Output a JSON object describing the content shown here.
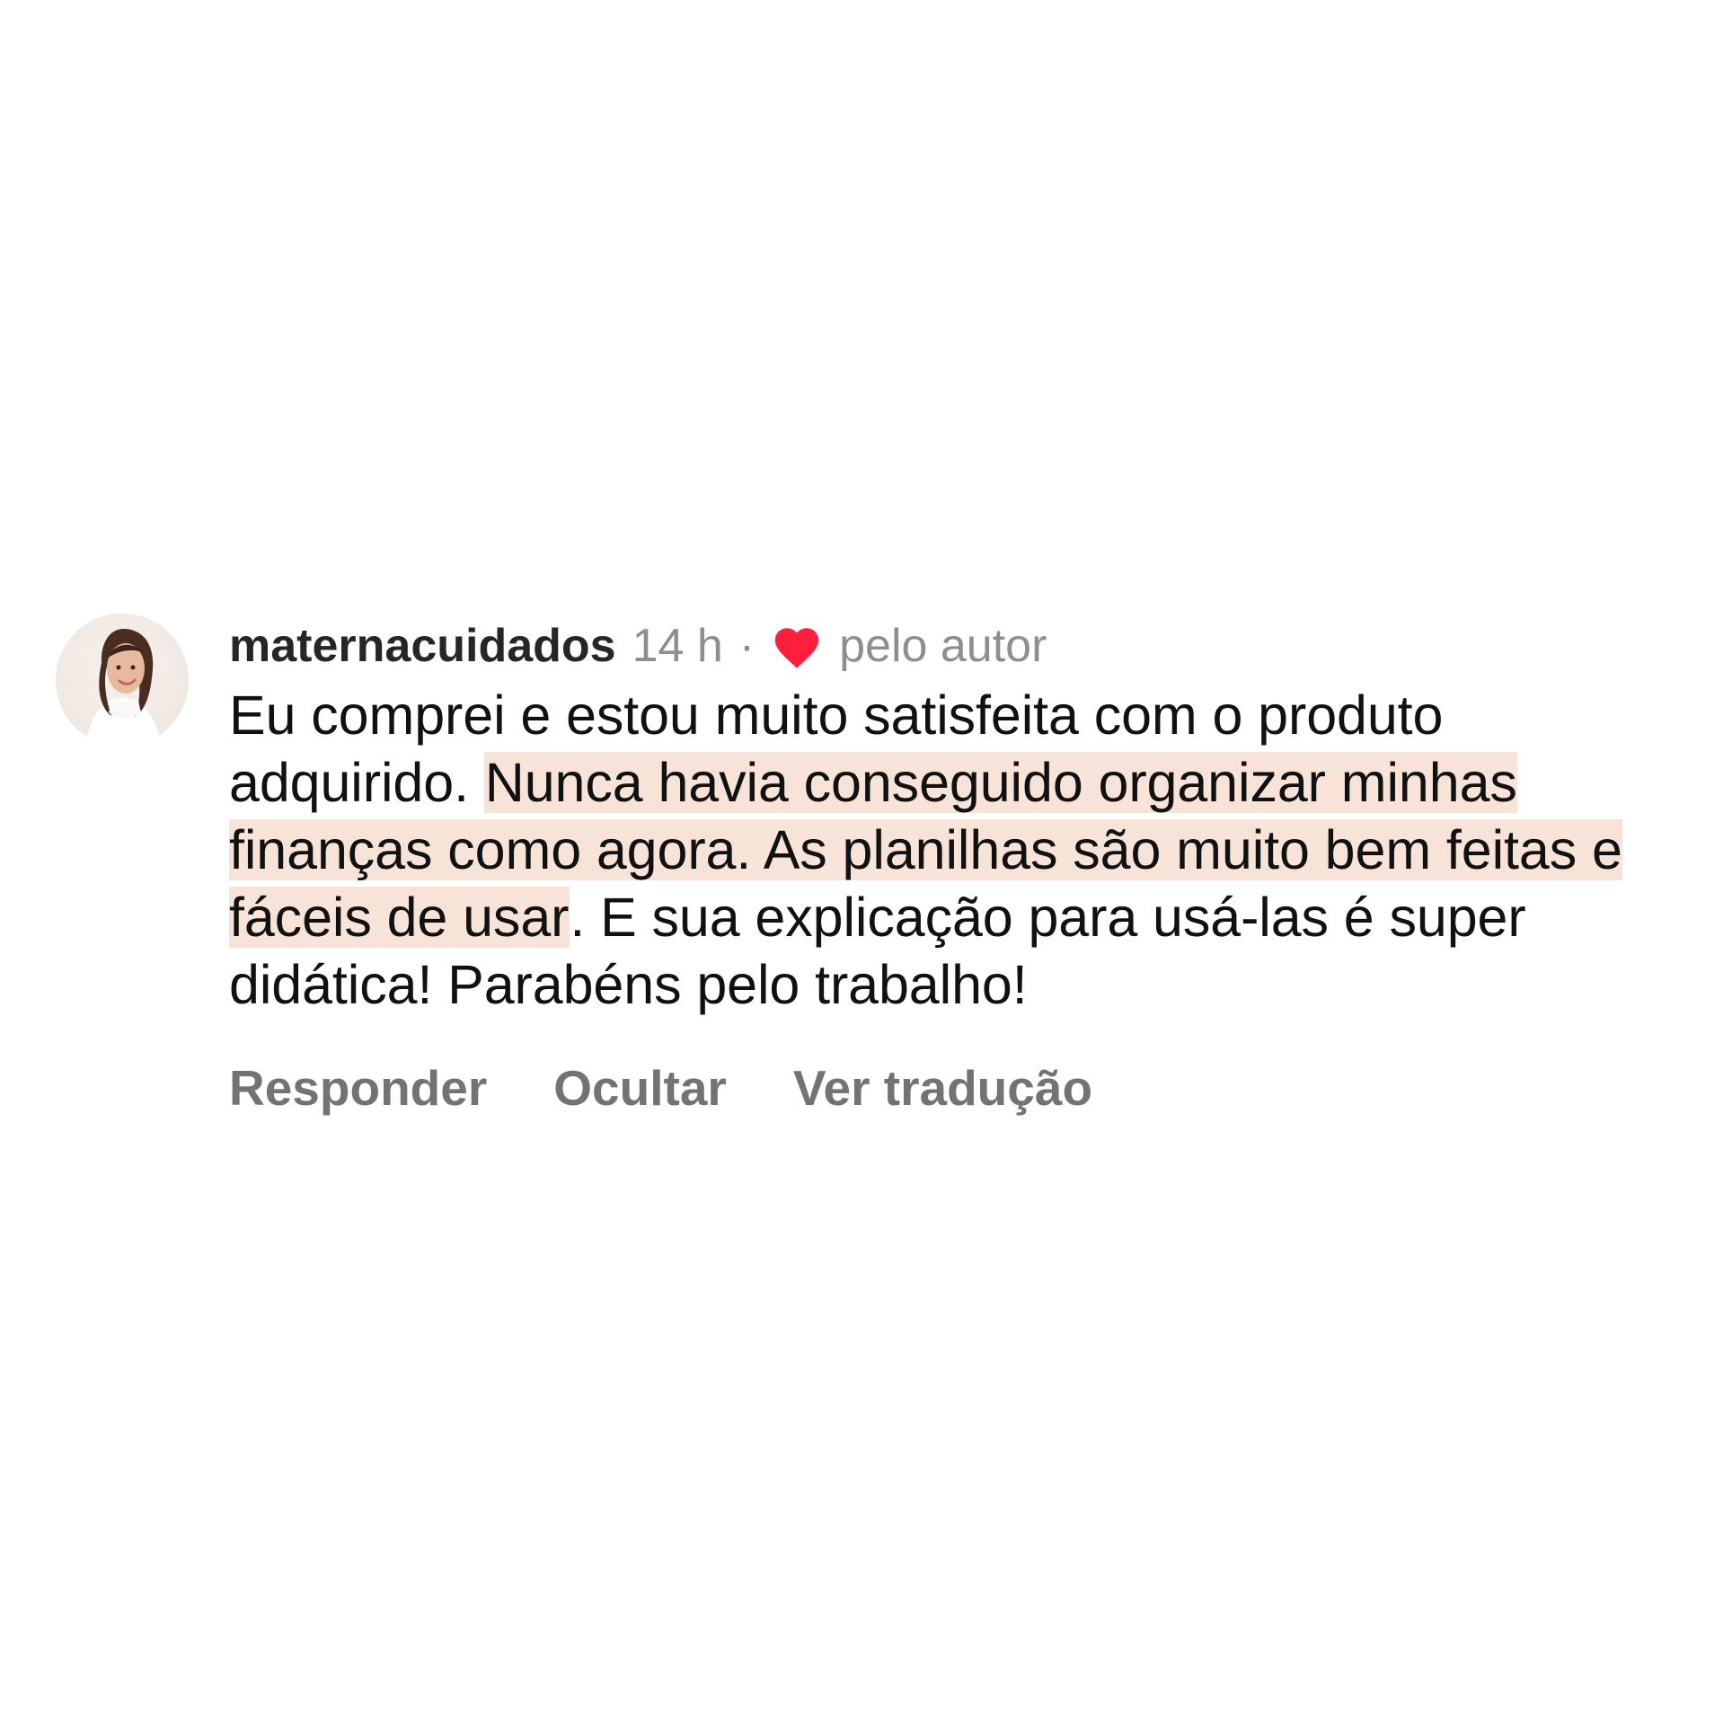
{
  "comment": {
    "username": "maternacuidados",
    "time": "14 h",
    "separator": "·",
    "liked_by": "pelo autor",
    "text_parts": [
      {
        "text": "Eu comprei e estou muito satisfeita com o produto adquirido. ",
        "highlighted": false
      },
      {
        "text": "Nunca havia conseguido organizar minhas finanças como agora. As planilhas são muito bem feitas e fáceis de usar",
        "highlighted": true
      },
      {
        "text": ". E sua explicação para usá-las é super didática! Parabéns pelo trabalho!",
        "highlighted": false
      }
    ],
    "actions": {
      "reply": "Responder",
      "hide": "Ocultar",
      "translate": "Ver tradução"
    },
    "icons": {
      "avatar": "profile-photo",
      "heart": "heart-icon"
    },
    "colors": {
      "highlight": "#f8e3d8",
      "heart": "#ff1f3d",
      "muted_text": "#8e8e8e",
      "action_text": "#737373"
    }
  }
}
